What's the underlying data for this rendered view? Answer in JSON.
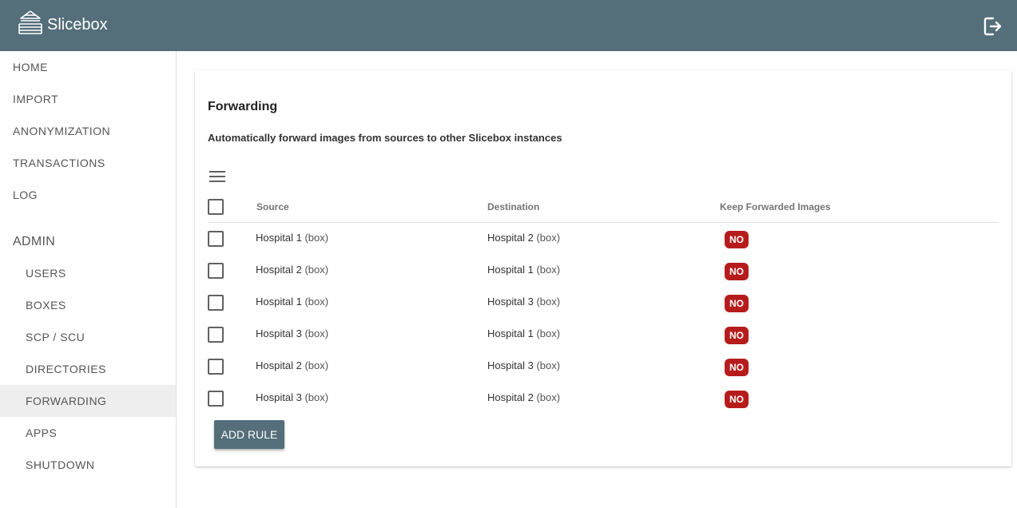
{
  "app": {
    "title": "Slicebox",
    "logo_icon": "slicebox-logo-icon",
    "logout_icon": "logout-icon"
  },
  "colors": {
    "header": "#546e7a",
    "badge_no": "#b71c1c",
    "button": "#546e7a",
    "active_nav": "#eeeeee"
  },
  "sidebar": {
    "items": [
      {
        "label": "HOME"
      },
      {
        "label": "IMPORT"
      },
      {
        "label": "ANONYMIZATION"
      },
      {
        "label": "TRANSACTIONS"
      },
      {
        "label": "LOG"
      }
    ],
    "admin_label": "ADMIN",
    "admin_items": [
      {
        "label": "USERS"
      },
      {
        "label": "BOXES"
      },
      {
        "label": "SCP / SCU"
      },
      {
        "label": "DIRECTORIES"
      },
      {
        "label": "FORWARDING",
        "active": true
      },
      {
        "label": "APPS"
      },
      {
        "label": "SHUTDOWN"
      }
    ]
  },
  "main": {
    "title": "Forwarding",
    "description": "Automatically forward images from sources to other Slicebox instances",
    "menu_icon": "hamburger-menu-icon",
    "table": {
      "columns": [
        "Source",
        "Destination",
        "Keep Forwarded Images"
      ],
      "rows": [
        {
          "source_name": "Hospital 1",
          "source_type": "(box)",
          "dest_name": "Hospital 2",
          "dest_type": "(box)",
          "keep": "NO"
        },
        {
          "source_name": "Hospital 2",
          "source_type": "(box)",
          "dest_name": "Hospital 1",
          "dest_type": "(box)",
          "keep": "NO"
        },
        {
          "source_name": "Hospital 1",
          "source_type": "(box)",
          "dest_name": "Hospital 3",
          "dest_type": "(box)",
          "keep": "NO"
        },
        {
          "source_name": "Hospital 3",
          "source_type": "(box)",
          "dest_name": "Hospital 1",
          "dest_type": "(box)",
          "keep": "NO"
        },
        {
          "source_name": "Hospital 2",
          "source_type": "(box)",
          "dest_name": "Hospital 3",
          "dest_type": "(box)",
          "keep": "NO"
        },
        {
          "source_name": "Hospital 3",
          "source_type": "(box)",
          "dest_name": "Hospital 2",
          "dest_type": "(box)",
          "keep": "NO"
        }
      ]
    },
    "add_button_label": "ADD RULE"
  }
}
